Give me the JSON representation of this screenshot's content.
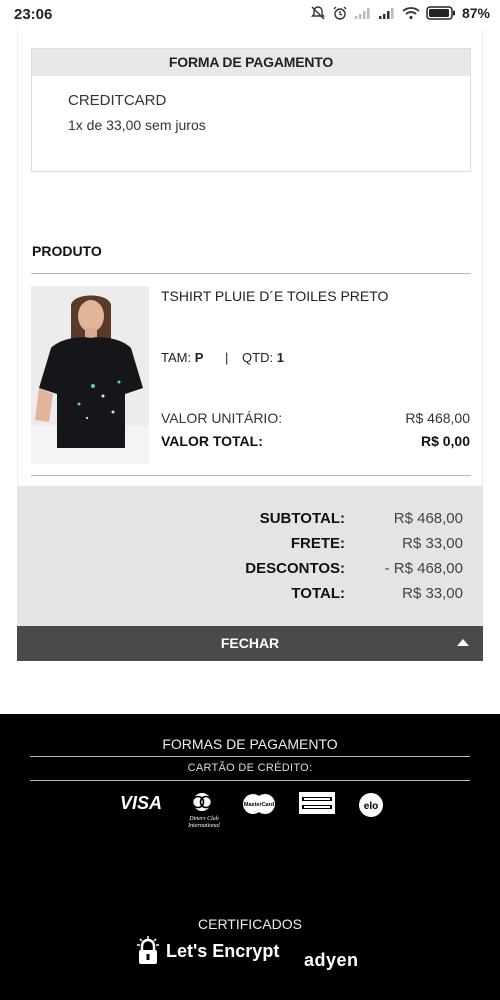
{
  "status_bar": {
    "time": "23:06",
    "battery": "87%"
  },
  "payment": {
    "title": "FORMA DE PAGAMENTO",
    "method": "CREDITCARD",
    "installments": "1x de 33,00 sem juros"
  },
  "product": {
    "section_title": "PRODUTO",
    "name": "TSHIRT PLUIE D´E TOILES PRETO",
    "size_label": "TAM:",
    "size_value": "P",
    "qty_label": "QTD:",
    "qty_value": "1",
    "unit_label": "VALOR UNITÁRIO:",
    "unit_value": "R$ 468,00",
    "total_label": "VALOR TOTAL:",
    "total_value": "R$ 0,00"
  },
  "summary": {
    "rows": [
      {
        "label": "SUBTOTAL:",
        "value": "R$ 468,00"
      },
      {
        "label": "FRETE:",
        "value": "R$ 33,00"
      },
      {
        "label": "DESCONTOS:",
        "value": "- R$ 468,00"
      },
      {
        "label": "TOTAL:",
        "value": "R$ 33,00"
      }
    ],
    "close_label": "FECHAR"
  },
  "footer": {
    "payment_title": "FORMAS DE PAGAMENTO",
    "credit_label": "CARTÃO DE CRÉDITO:",
    "cards": [
      "VISA",
      "Diners Club International",
      "MasterCard",
      "American Express",
      "elo"
    ],
    "cert_title": "CERTIFICADOS",
    "cert1": "Let's Encrypt",
    "cert2": "adyen"
  },
  "colors": {
    "close_bar": "#4a4a4a",
    "summary_bg": "#e4e4e4",
    "footer_bg": "#000000"
  }
}
